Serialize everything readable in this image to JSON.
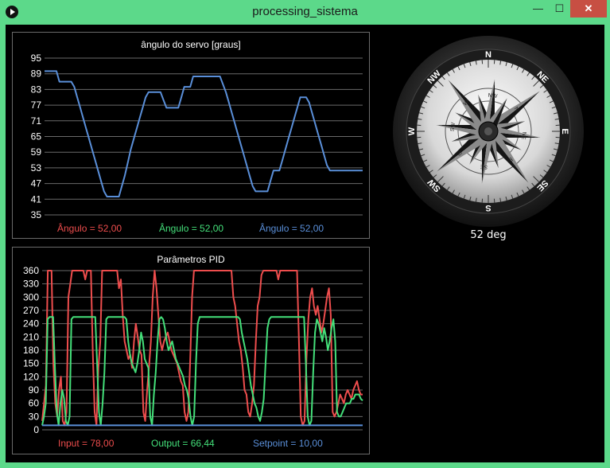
{
  "window": {
    "title": "processing_sistema",
    "minimize": "—",
    "maximize": "☐",
    "close": "✕"
  },
  "servo_chart": {
    "chart_data": {
      "type": "line",
      "title": "ângulo do servo [graus]",
      "ylim": [
        35,
        95
      ],
      "yticks": [
        95,
        89,
        83,
        77,
        71,
        65,
        59,
        53,
        47,
        41,
        35
      ],
      "series": [
        {
          "name": "Ângulo",
          "color": "#5a8fd9",
          "values": [
            90,
            90,
            90,
            90,
            90,
            86,
            86,
            86,
            86,
            86,
            84,
            80,
            76,
            72,
            68,
            64,
            60,
            56,
            52,
            48,
            44,
            42,
            42,
            42,
            42,
            42,
            46,
            50,
            55,
            60,
            64,
            68,
            72,
            76,
            80,
            82,
            82,
            82,
            82,
            82,
            79,
            76,
            76,
            76,
            76,
            76,
            80,
            84,
            84,
            84,
            88,
            88,
            88,
            88,
            88,
            88,
            88,
            88,
            88,
            88,
            85,
            82,
            78,
            74,
            70,
            66,
            62,
            58,
            54,
            50,
            46,
            44,
            44,
            44,
            44,
            44,
            48,
            52,
            52,
            52,
            56,
            60,
            64,
            68,
            72,
            76,
            80,
            80,
            80,
            78,
            74,
            70,
            66,
            62,
            58,
            54,
            52,
            52,
            52,
            52,
            52,
            52,
            52,
            52,
            52,
            52,
            52,
            52
          ]
        }
      ]
    },
    "legend": [
      {
        "text": "Ângulo = 52,00",
        "color": "#ee4d4d"
      },
      {
        "text": "Ângulo = 52,00",
        "color": "#44e07a"
      },
      {
        "text": "Ângulo = 52,00",
        "color": "#5a8fd9"
      }
    ]
  },
  "pid_chart": {
    "chart_data": {
      "type": "line",
      "title": "Parâmetros PID",
      "ylim": [
        0,
        360
      ],
      "yticks": [
        360,
        330,
        300,
        270,
        240,
        210,
        180,
        150,
        120,
        90,
        60,
        30,
        0
      ],
      "series": [
        {
          "name": "Input",
          "color": "#ee4d4d",
          "values": [
            20,
            60,
            100,
            360,
            360,
            360,
            150,
            60,
            30,
            90,
            120,
            20,
            10,
            40,
            300,
            330,
            360,
            360,
            360,
            360,
            360,
            360,
            360,
            340,
            360,
            360,
            360,
            180,
            40,
            10,
            140,
            200,
            360,
            360,
            360,
            360,
            360,
            360,
            360,
            360,
            360,
            320,
            340,
            260,
            200,
            180,
            160,
            170,
            140,
            200,
            240,
            210,
            180,
            170,
            40,
            20,
            90,
            140,
            200,
            300,
            360,
            320,
            260,
            200,
            180,
            200,
            210,
            220,
            200,
            180,
            170,
            160,
            150,
            130,
            110,
            100,
            40,
            20,
            40,
            160,
            300,
            360,
            360,
            360,
            360,
            360,
            360,
            360,
            360,
            360,
            360,
            360,
            360,
            360,
            360,
            360,
            360,
            360,
            360,
            360,
            360,
            360,
            300,
            280,
            240,
            200,
            180,
            140,
            90,
            80,
            40,
            30,
            60,
            100,
            200,
            280,
            300,
            350,
            360,
            360,
            360,
            360,
            360,
            360,
            360,
            360,
            340,
            360,
            360,
            360,
            360,
            360,
            360,
            360,
            360,
            360,
            360,
            200,
            30,
            10,
            20,
            160,
            250,
            300,
            320,
            280,
            260,
            280,
            250,
            220,
            240,
            270,
            300,
            320,
            260,
            40,
            30,
            40,
            60,
            80,
            70,
            60,
            80,
            90,
            80,
            70,
            90,
            100,
            110,
            90,
            80,
            80
          ]
        },
        {
          "name": "Output",
          "color": "#44e07a",
          "values": [
            10,
            30,
            60,
            250,
            255,
            255,
            255,
            140,
            40,
            10,
            60,
            90,
            70,
            20,
            10,
            30,
            250,
            255,
            255,
            255,
            255,
            255,
            255,
            255,
            255,
            255,
            255,
            255,
            255,
            255,
            150,
            40,
            10,
            60,
            130,
            250,
            255,
            255,
            255,
            255,
            255,
            255,
            255,
            255,
            255,
            255,
            250,
            200,
            170,
            150,
            140,
            130,
            150,
            180,
            220,
            200,
            160,
            150,
            140,
            30,
            10,
            80,
            130,
            200,
            250,
            255,
            250,
            230,
            200,
            180,
            190,
            200,
            180,
            160,
            150,
            140,
            130,
            120,
            100,
            90,
            70,
            30,
            10,
            30,
            150,
            240,
            255,
            255,
            255,
            255,
            255,
            255,
            255,
            255,
            255,
            255,
            255,
            255,
            255,
            255,
            255,
            255,
            255,
            255,
            255,
            255,
            255,
            255,
            250,
            220,
            200,
            180,
            160,
            130,
            100,
            80,
            60,
            50,
            30,
            20,
            40,
            70,
            150,
            230,
            250,
            255,
            255,
            255,
            255,
            255,
            255,
            255,
            255,
            255,
            255,
            255,
            255,
            255,
            255,
            255,
            255,
            255,
            255,
            255,
            150,
            30,
            10,
            20,
            130,
            220,
            250,
            240,
            220,
            200,
            230,
            210,
            180,
            200,
            230,
            250,
            200,
            40,
            30,
            30,
            40,
            50,
            60,
            60,
            60,
            70,
            70,
            80,
            80,
            80,
            70,
            66
          ]
        },
        {
          "name": "Setpoint",
          "color": "#5a8fd9",
          "values": [
            10,
            10,
            10,
            10,
            10,
            10,
            10,
            10,
            10,
            10,
            10,
            10,
            10,
            10,
            10,
            10,
            10,
            10,
            10,
            10,
            10,
            10,
            10,
            10,
            10,
            10,
            10,
            10,
            10,
            10,
            10,
            10,
            10,
            10,
            10,
            10,
            10,
            10,
            10,
            10,
            10,
            10,
            10,
            10,
            10,
            10,
            10,
            10,
            10,
            10,
            10,
            10,
            10,
            10,
            10,
            10,
            10,
            10,
            10,
            10,
            10,
            10,
            10,
            10,
            10,
            10,
            10,
            10,
            10,
            10,
            10,
            10,
            10,
            10,
            10,
            10,
            10,
            10,
            10,
            10,
            10,
            10,
            10,
            10,
            10,
            10,
            10,
            10,
            10,
            10,
            10,
            10,
            10,
            10,
            10,
            10,
            10,
            10,
            10,
            10,
            10,
            10,
            10,
            10,
            10,
            10,
            10,
            10,
            10,
            10,
            10,
            10,
            10,
            10,
            10,
            10,
            10,
            10,
            10,
            10,
            10,
            10,
            10,
            10,
            10,
            10,
            10,
            10,
            10,
            10,
            10,
            10,
            10,
            10,
            10,
            10,
            10,
            10,
            10,
            10,
            10,
            10,
            10,
            10,
            10,
            10,
            10,
            10,
            10,
            10,
            10,
            10,
            10,
            10,
            10,
            10,
            10,
            10,
            10,
            10,
            10,
            10,
            10,
            10,
            10,
            10,
            10,
            10,
            10,
            10,
            10,
            10,
            10,
            10,
            10,
            10,
            10,
            10
          ]
        }
      ]
    },
    "legend": [
      {
        "text": "Input = 78,00",
        "color": "#ee4d4d"
      },
      {
        "text": "Output = 66,44",
        "color": "#44e07a"
      },
      {
        "text": "Setpoint = 10,00",
        "color": "#5a8fd9"
      }
    ]
  },
  "compass": {
    "heading_label": "52 deg",
    "heading_value": 52,
    "outer_labels": [
      "N",
      "NE",
      "E",
      "SE",
      "S",
      "SW",
      "W",
      "NW"
    ],
    "inner_labels": [
      "N",
      "NE",
      "E",
      "SE",
      "S",
      "SW",
      "W",
      "NW"
    ]
  }
}
